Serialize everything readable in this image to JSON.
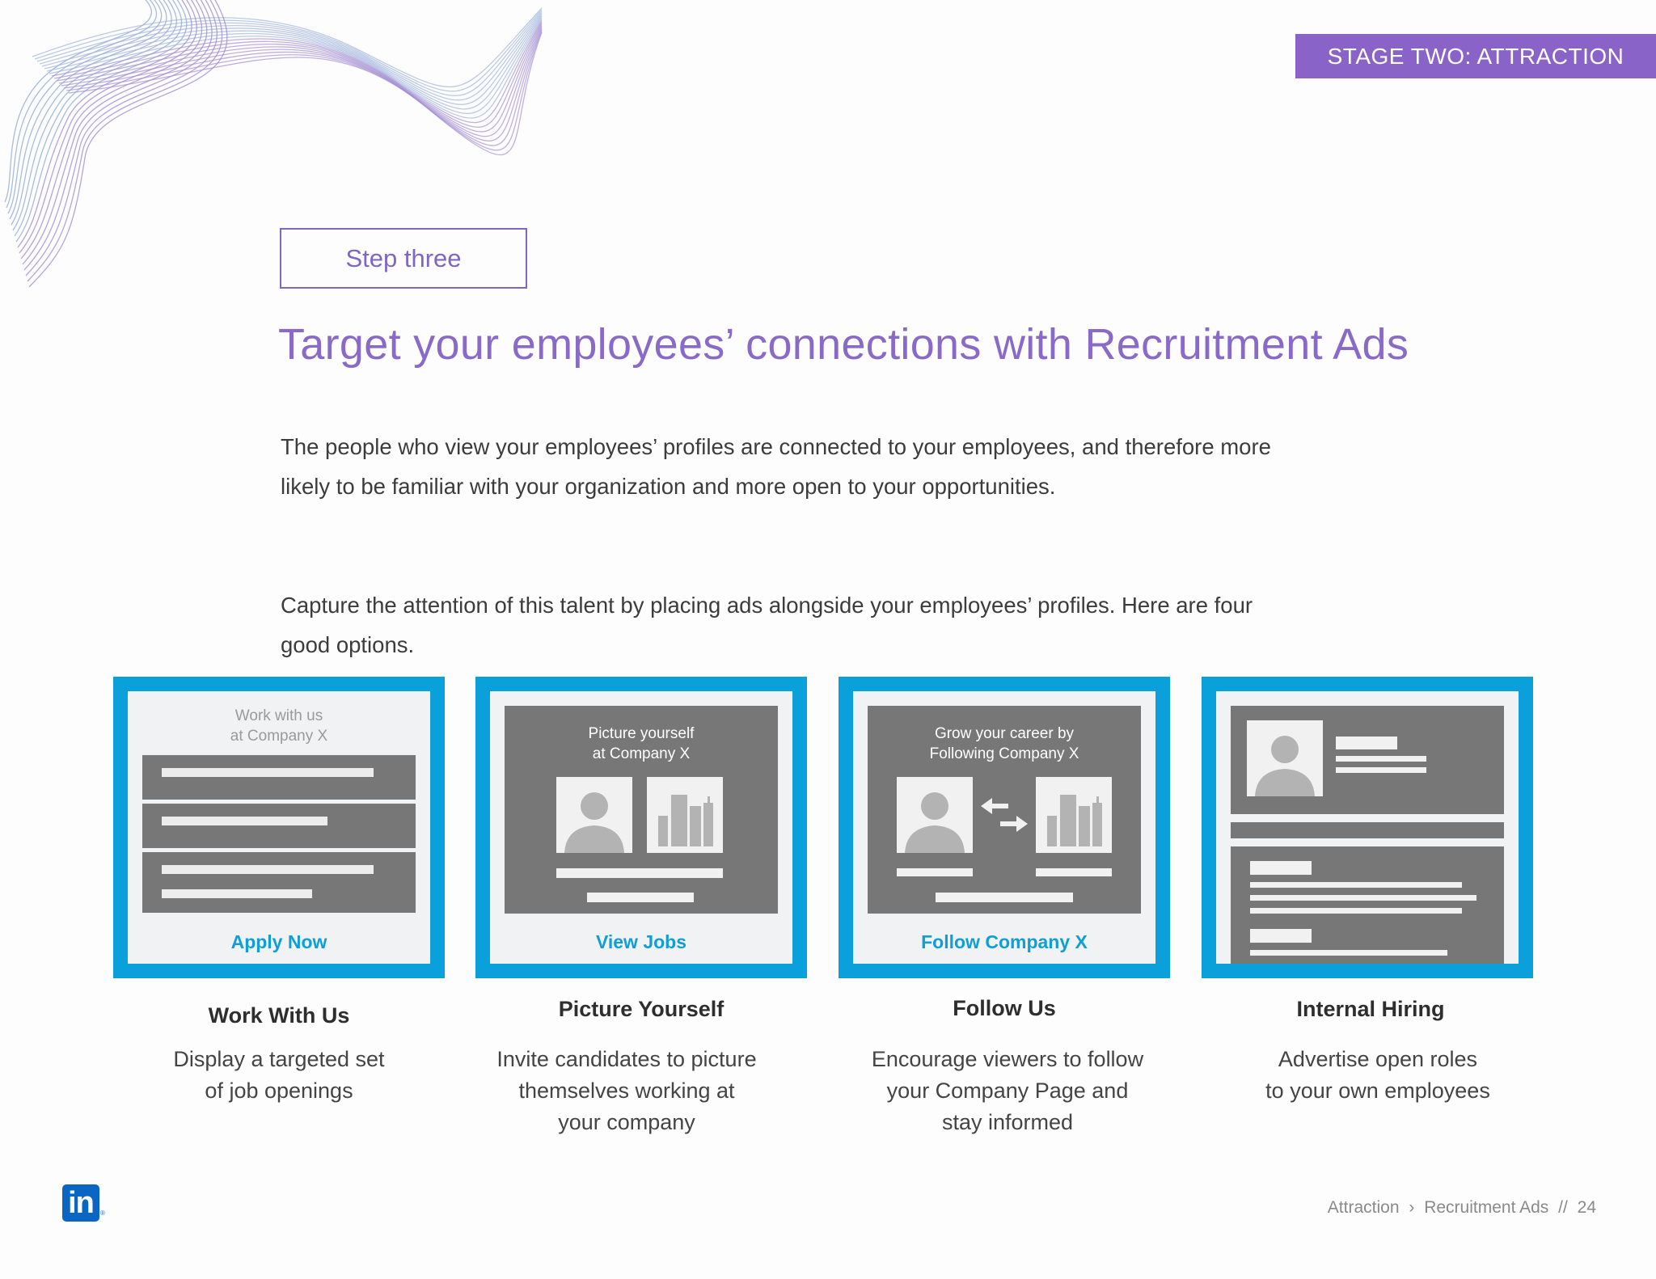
{
  "banner": "STAGE TWO: ATTRACTION",
  "step_label": "Step three",
  "heading": "Target your employees’ connections with Recruitment Ads",
  "paragraphs": [
    "The people who view your employees’ profiles are connected to your employees, and therefore more likely to be familiar with your organization and more open to your opportunities.",
    "Capture the attention of this talent by placing ads alongside your employees’ profiles. Here are four good options."
  ],
  "cards": [
    {
      "mock_caption": [
        "Work with us",
        "at Company X"
      ],
      "cta": "Apply Now",
      "title": "Work With Us",
      "description": [
        "Display a targeted set",
        "of job openings"
      ]
    },
    {
      "mock_caption": [
        "Picture yourself",
        "at Company X"
      ],
      "cta": "View Jobs",
      "title": "Picture Yourself",
      "description": [
        "Invite candidates to picture",
        "themselves working at",
        "your company"
      ]
    },
    {
      "mock_caption": [
        "Grow your career by",
        "Following Company X"
      ],
      "cta": "Follow Company X",
      "title": "Follow Us",
      "description": [
        "Encourage viewers to follow",
        "your Company Page and",
        "stay informed"
      ]
    },
    {
      "title": "Internal Hiring",
      "description": [
        "Advertise open roles",
        "to your own employees"
      ]
    }
  ],
  "logo": {
    "text": "in",
    "mark": "®"
  },
  "footer": {
    "section": "Attraction",
    "separator": "›",
    "subsection": "Recruitment Ads",
    "divider": "//",
    "page": "24"
  },
  "colors": {
    "accent_purple": "#8a63c9",
    "ad_blue": "#0aa0dc",
    "linkedin_blue": "#0a66c2"
  }
}
